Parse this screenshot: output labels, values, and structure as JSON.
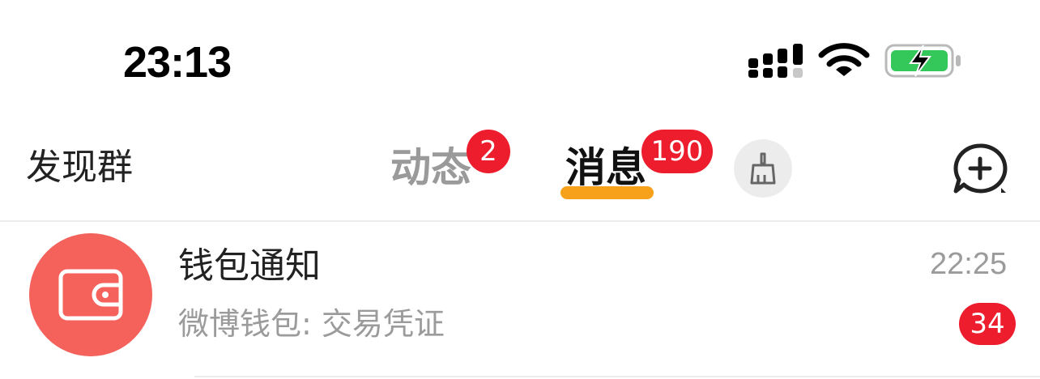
{
  "status_bar": {
    "time": "23:13",
    "icons": [
      "signal-icon",
      "wifi-icon",
      "battery-charging-icon"
    ]
  },
  "nav": {
    "left_label": "发现群",
    "tabs": [
      {
        "label": "动态",
        "badge": "2",
        "active": false
      },
      {
        "label": "消息",
        "badge": "190",
        "active": true
      }
    ],
    "actions": [
      "broom-clean-icon",
      "add-chat-icon"
    ],
    "colors": {
      "active_underline": "#f7a11a",
      "badge": "#ee1d2e"
    }
  },
  "messages": [
    {
      "title": "钱包通知",
      "subtitle": "微博钱包: 交易凭证",
      "time": "22:25",
      "unread": "34",
      "icon": "wallet-icon",
      "avatar_color": "#f4625b"
    }
  ]
}
